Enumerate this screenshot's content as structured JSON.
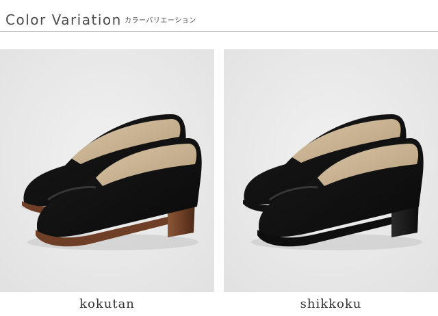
{
  "header": {
    "title": "Color Variation",
    "subtitle": "カラーバリエーション"
  },
  "variants": [
    {
      "label": "kokutan",
      "heel_color": "#6e3f26",
      "shoe_color": "#161616"
    },
    {
      "label": "shikkoku",
      "heel_color": "#141414",
      "shoe_color": "#161616"
    }
  ]
}
